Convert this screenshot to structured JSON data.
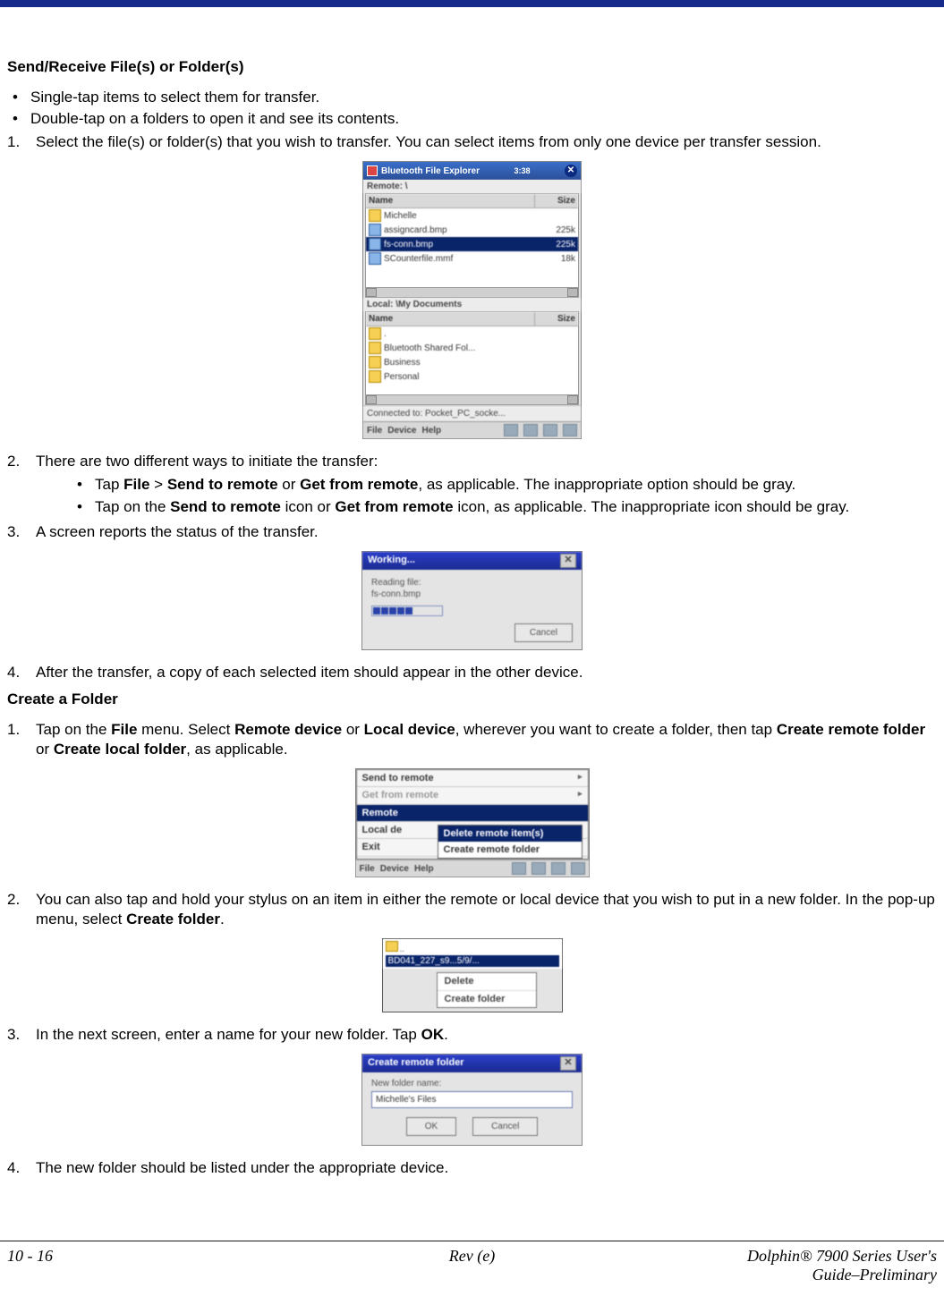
{
  "section1_title": "Send/Receive File(s) or Folder(s)",
  "bullets1": {
    "b1": "Single-tap items to select them for transfer.",
    "b2": "Double-tap on a folders to open it and see its contents."
  },
  "step1_1": "Select the file(s) or folder(s) that you wish to transfer. You can select items from only one device per transfer session.",
  "fig1": {
    "title": "Bluetooth File Explorer",
    "clock": "3:38",
    "remote_label": "Remote: \\",
    "hdr_name": "Name",
    "hdr_size": "Size",
    "remote_rows": {
      "r0": {
        "name": "Michelle",
        "size": ""
      },
      "r1": {
        "name": "assigncard.bmp",
        "size": "225k"
      },
      "r2": {
        "name": "fs-conn.bmp",
        "size": "225k"
      },
      "r3": {
        "name": "SCounterfile.mmf",
        "size": "18k"
      }
    },
    "local_label": "Local: \\My Documents",
    "local_rows": {
      "r0": {
        "name": ".",
        "size": ""
      },
      "r1": {
        "name": "Bluetooth Shared Fol...",
        "size": ""
      },
      "r2": {
        "name": "Business",
        "size": ""
      },
      "r3": {
        "name": "Personal",
        "size": ""
      }
    },
    "status": "Connected to: Pocket_PC_socke...",
    "tb1": "File",
    "tb2": "Device",
    "tb3": "Help"
  },
  "step1_2": "There are two different ways to initiate the transfer:",
  "sub1": {
    "a_pre": "Tap ",
    "a_b1": "File",
    "a_mid1": " > ",
    "a_b2": "Send to remote",
    "a_mid2": " or ",
    "a_b3": "Get from remote",
    "a_post": ", as applicable. The inappropriate option should be gray.",
    "b_pre": "Tap on the ",
    "b_b1": "Send to remote",
    "b_mid": " icon or ",
    "b_b2": "Get from remote",
    "b_post": " icon, as applicable. The inappropriate icon should be gray."
  },
  "step1_3": "A screen reports the status of the transfer.",
  "fig2": {
    "title": "Working...",
    "line1": "Reading file:",
    "line2": "fs-conn.bmp",
    "cancel": "Cancel"
  },
  "step1_4": "After the transfer, a copy of each selected item should appear in the other device.",
  "section2_title": "Create a Folder",
  "step2_1_pre": "Tap on the ",
  "step2_1_b1": "File",
  "step2_1_mid1": " menu. Select ",
  "step2_1_b2": "Remote device",
  "step2_1_mid2": " or ",
  "step2_1_b3": "Local device",
  "step2_1_mid3": ", wherever you want to create a folder, then tap ",
  "step2_1_b4": "Create remote folder",
  "step2_1_mid4": " or ",
  "step2_1_b5": "Create local folder",
  "step2_1_post": ", as applicable.",
  "fig3": {
    "m1": "Send to remote",
    "m2": "Get from remote",
    "m3": "Remote",
    "m4": "Local de",
    "m5": "Exit",
    "s1": "Delete remote item(s)",
    "s2": "Create remote folder",
    "tb1": "File",
    "tb2": "Device",
    "tb3": "Help"
  },
  "step2_2_pre": "You can also tap and hold your stylus on an item in either the remote or local device that you wish to put in a new folder. In the pop-up menu, select ",
  "step2_2_b": "Create folder",
  "step2_2_post": ".",
  "fig4": {
    "row": "BD041_227_s9...5/9/...",
    "p1": "Delete",
    "p2": "Create folder"
  },
  "step2_3_pre": "In the next screen, enter a name for your new folder. Tap ",
  "step2_3_b": "OK",
  "step2_3_post": ".",
  "fig5": {
    "title": "Create remote folder",
    "label": "New folder name:",
    "value": "Michelle's Files",
    "ok": "OK",
    "cancel": "Cancel"
  },
  "step2_4": "The new folder should be listed under the appropriate device.",
  "footer": {
    "left": "10 - 16",
    "center": "Rev (e)",
    "right1": "Dolphin® 7900 Series User's",
    "right2": "Guide–Preliminary"
  }
}
